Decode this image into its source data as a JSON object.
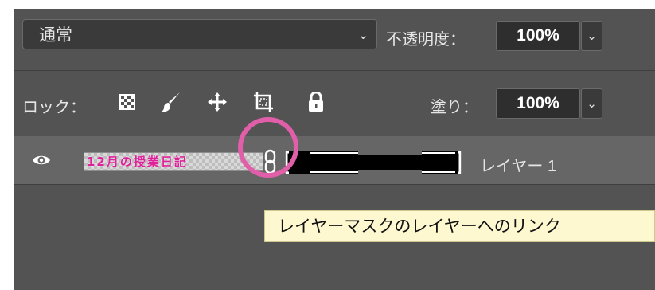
{
  "blend_mode": {
    "value": "通常"
  },
  "opacity": {
    "label": "不透明度：",
    "value": "100%"
  },
  "lock": {
    "label": "ロック："
  },
  "fill": {
    "label": "塗り：",
    "value": "100%"
  },
  "layer": {
    "thumbnail_text": "12月の授業日記",
    "name": "レイヤー 1"
  },
  "tooltip": {
    "text": "レイヤーマスクのレイヤーへのリンク"
  },
  "colors": {
    "panel_bg": "#535353",
    "selected_row_bg": "#666666",
    "highlight_circle": "#e05fa8",
    "thumbnail_text": "#e0209a",
    "tooltip_bg": "#fdf8d0"
  },
  "icons": {
    "lock_buttons": [
      "lock-transparent-pixels-icon",
      "lock-image-pixels-icon",
      "lock-position-icon",
      "prevent-auto-nesting-icon",
      "lock-all-icon"
    ],
    "layer": [
      "eye-icon",
      "link-icon"
    ]
  }
}
